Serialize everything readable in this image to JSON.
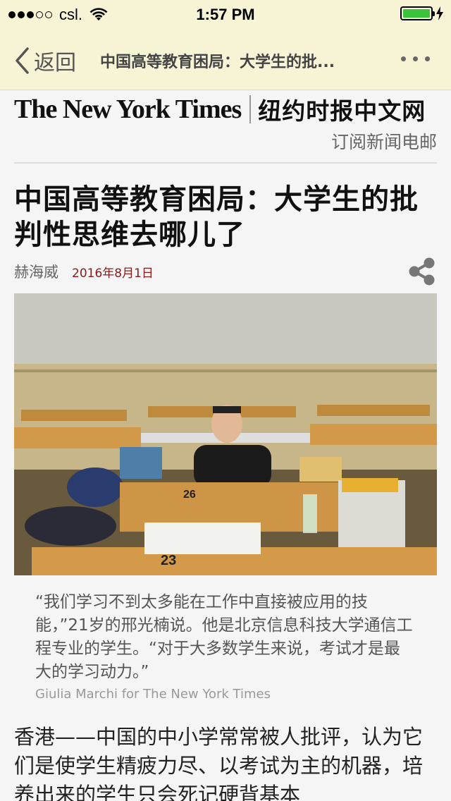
{
  "status_bar": {
    "carrier": "csl.",
    "time": "1:57 PM",
    "battery_level": 1.0
  },
  "nav": {
    "back_label": "返回",
    "title": "中国高等教育困局：大学生的批..."
  },
  "masthead": {
    "logo_en": "The New York Times",
    "logo_cn": "纽约时报中文网",
    "subscribe_label": "订阅新闻电邮"
  },
  "article": {
    "headline": "中国高等教育困局：大学生的批判性思维去哪儿了",
    "author": "赫海威",
    "date": "2016年8月1日",
    "caption": "“我们学习不到太多能在工作中直接被应用的技能，”21岁的邢光楠说。他是北京信息科技大学通信工程专业的学生。“对于大多数学生来说，考试才是最大的学习动力。”",
    "photo_credit": "Giulia Marchi for The New York Times",
    "photo_desk_numbers": [
      "26",
      "23"
    ],
    "body": "香港——中国的中小学常常被人批评，认为它们是使学生精疲力尽、以考试为主的机器，培养出来的学生只会死记硬背基本"
  },
  "colors": {
    "bar_bg": "#f7f4d6",
    "date_red": "#8b1a1a",
    "battery_green": "#3cc33c"
  }
}
